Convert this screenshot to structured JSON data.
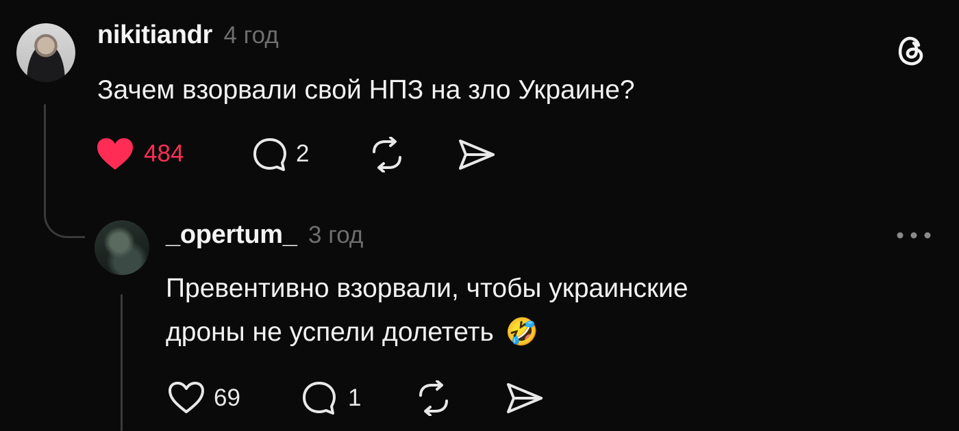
{
  "post": {
    "username": "nikitiandr",
    "time": "4 год",
    "text": "Зачем взорвали свой НПЗ на зло Украине?",
    "likes": "484",
    "replies": "2",
    "liked": true
  },
  "reply": {
    "username": "_opertum_",
    "time": "3 год",
    "text_line1": "Превентивно взорвали, чтобы украинские",
    "text_line2": "дроны не успели долететь",
    "emoji": "🤣",
    "likes": "69",
    "replies": "1",
    "liked": false
  },
  "colors": {
    "background": "#0a0a0a",
    "like_active": "#ff2d55",
    "muted": "#6e6e6e"
  },
  "icons": [
    "threads-logo-icon",
    "heart-icon",
    "comment-icon",
    "repost-icon",
    "share-icon",
    "more-icon"
  ]
}
